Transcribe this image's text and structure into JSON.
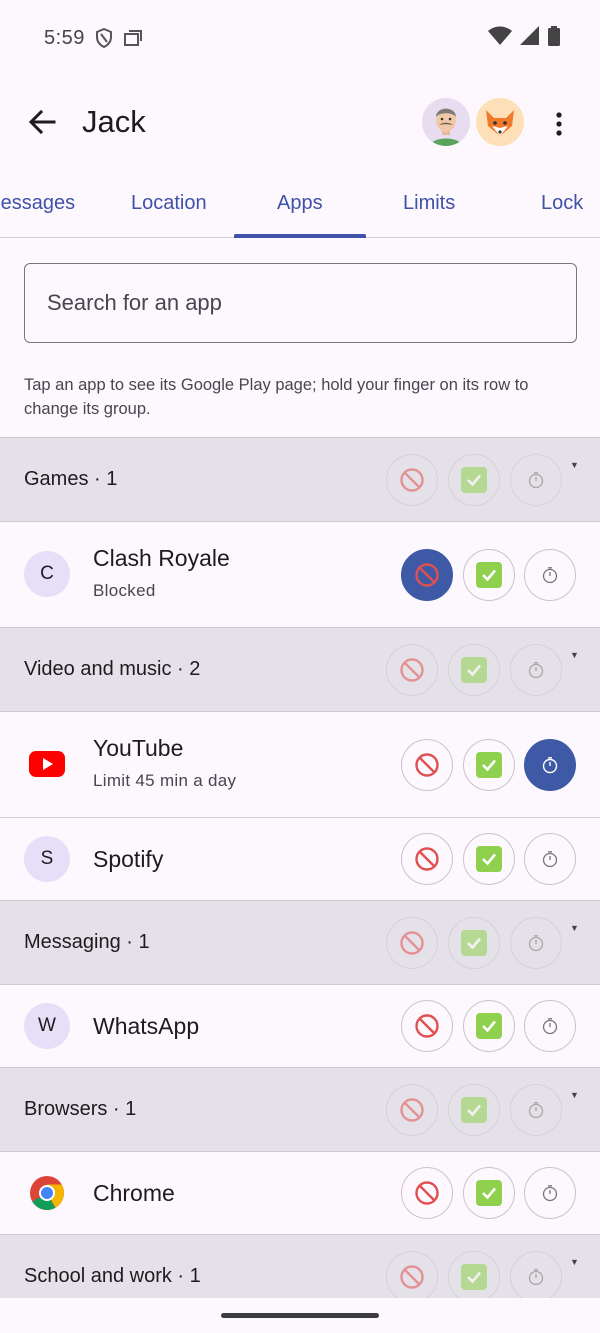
{
  "status_bar": {
    "time": "5:59"
  },
  "app_bar": {
    "title": "Jack"
  },
  "tabs": [
    "Messages",
    "Location",
    "Apps",
    "Limits",
    "Lock"
  ],
  "active_tab": "Apps",
  "search": {
    "placeholder": "Search for an app"
  },
  "hint": "Tap an app to see its Google Play page; hold your finger on its row to change its group.",
  "groups": [
    {
      "label": "Games · 1",
      "apps": [
        {
          "name": "Clash Royale",
          "initial": "C",
          "subtitle": "Blocked",
          "state": "blocked"
        }
      ]
    },
    {
      "label": "Video and music · 2",
      "apps": [
        {
          "name": "YouTube",
          "icon": "youtube-icon",
          "subtitle": "Limit 45 min a day",
          "state": "limited"
        },
        {
          "name": "Spotify",
          "initial": "S",
          "state": "none"
        }
      ]
    },
    {
      "label": "Messaging · 1",
      "apps": [
        {
          "name": "WhatsApp",
          "initial": "W",
          "state": "none"
        }
      ]
    },
    {
      "label": "Browsers · 1",
      "apps": [
        {
          "name": "Chrome",
          "icon": "chrome-icon",
          "state": "none"
        }
      ]
    },
    {
      "label": "School and work · 1",
      "apps": []
    }
  ],
  "colors": {
    "accent": "#3f51a8",
    "selected_button": "#3e5aa6",
    "group_bg": "#e5e1e8",
    "background": "#fdf8fd"
  }
}
